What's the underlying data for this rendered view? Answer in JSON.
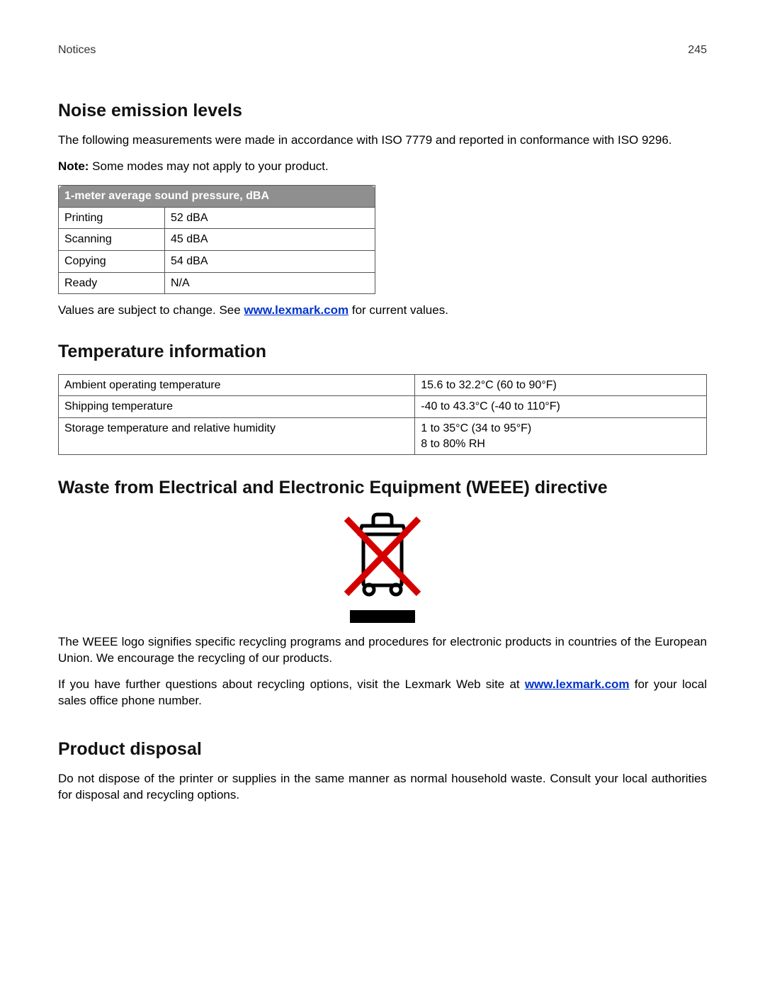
{
  "header": {
    "section": "Notices",
    "page": "245"
  },
  "noise": {
    "heading": "Noise emission levels",
    "intro": "The following measurements were made in accordance with ISO 7779 and reported in conformance with ISO 9296.",
    "note_label": "Note:",
    "note_text": " Some modes may not apply to your product.",
    "table_header": "1-meter average sound pressure, dBA",
    "rows": [
      {
        "mode": "Printing",
        "value": "52 dBA"
      },
      {
        "mode": "Scanning",
        "value": "45 dBA"
      },
      {
        "mode": "Copying",
        "value": "54 dBA"
      },
      {
        "mode": "Ready",
        "value": "N/A"
      }
    ],
    "footer_pre": "Values are subject to change. See ",
    "footer_link": "www.lexmark.com",
    "footer_post": " for current values."
  },
  "temp": {
    "heading": "Temperature information",
    "rows": [
      {
        "label": "Ambient operating temperature",
        "value": "15.6 to 32.2°C (60 to 90°F)"
      },
      {
        "label": "Shipping temperature",
        "value": "-40 to 43.3°C (-40 to 110°F)"
      },
      {
        "label": "Storage temperature and relative humidity",
        "value": "1 to 35°C (34 to 95°F)\n8 to 80% RH"
      }
    ]
  },
  "weee": {
    "heading": "Waste from Electrical and Electronic Equipment (WEEE) directive",
    "para1": "The WEEE logo signifies specific recycling programs and procedures for electronic products in countries of the European Union. We encourage the recycling of our products.",
    "para2_pre": "If you have further questions about recycling options, visit the Lexmark Web site at ",
    "para2_link": "www.lexmark.com",
    "para2_post": " for your local sales office phone number."
  },
  "disposal": {
    "heading": "Product disposal",
    "para": "Do not dispose of the printer or supplies in the same manner as normal household waste. Consult your local authorities for disposal and recycling options."
  }
}
